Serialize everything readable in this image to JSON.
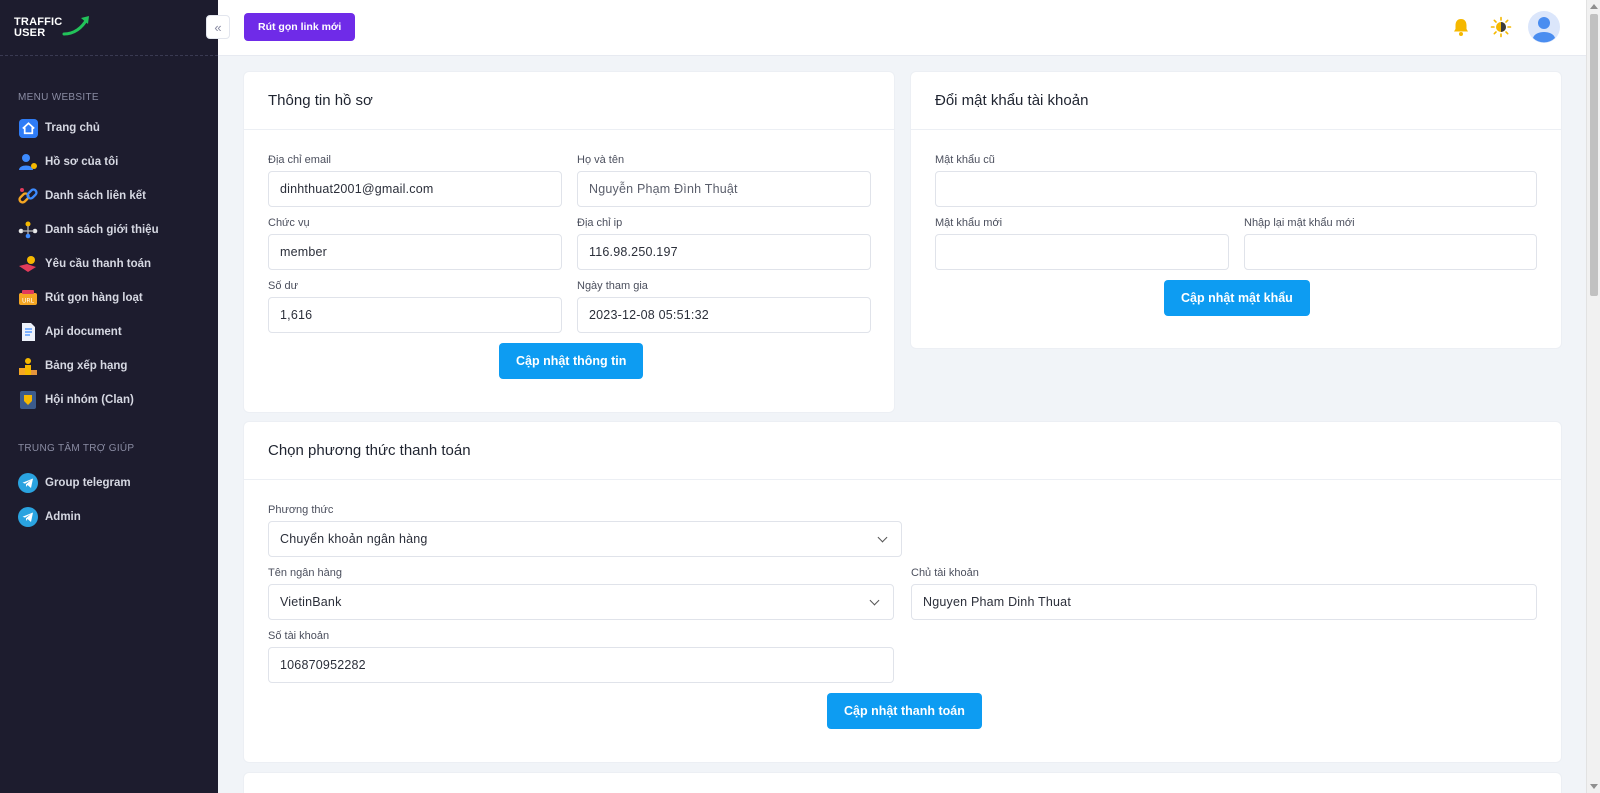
{
  "brand": {
    "line1": "TRAFFIC",
    "line2": "USER"
  },
  "sidebar": {
    "section_menu": "MENU WEBSITE",
    "items": [
      {
        "label": "Trang chủ",
        "icon": "home-icon"
      },
      {
        "label": "Hồ sơ của tôi",
        "icon": "user-profile-icon"
      },
      {
        "label": "Danh sách liên kết",
        "icon": "link-chain-icon"
      },
      {
        "label": "Danh sách giới thiệu",
        "icon": "referral-network-icon"
      },
      {
        "label": "Yêu cầu thanh toán",
        "icon": "payment-hand-icon"
      },
      {
        "label": "Rút gọn hàng loạt",
        "icon": "bulk-shorten-icon"
      },
      {
        "label": "Api document",
        "icon": "document-icon"
      },
      {
        "label": "Bảng xếp hạng",
        "icon": "ranking-podium-icon"
      },
      {
        "label": "Hội nhóm (Clan)",
        "icon": "clan-shield-icon"
      }
    ],
    "section_help": "TRUNG TÂM TRỢ GIÚP",
    "help_items": [
      {
        "label": "Group telegram",
        "icon": "telegram-icon"
      },
      {
        "label": "Admin",
        "icon": "telegram-icon"
      }
    ]
  },
  "header": {
    "new_link_label": "Rút gọn link mới",
    "icons": [
      "bell-icon",
      "theme-toggle-icon",
      "avatar-icon"
    ]
  },
  "profile": {
    "title": "Thông tin hồ sơ",
    "email_label": "Địa chỉ email",
    "email_value": "dinhthuat2001@gmail.com",
    "name_label": "Họ và tên",
    "name_value": "Nguyễn Phạm Đình Thuật",
    "role_label": "Chức vụ",
    "role_value": "member",
    "ip_label": "Địa chỉ ip",
    "ip_value": "116.98.250.197",
    "balance_label": "Số dư",
    "balance_value": "1,616",
    "joined_label": "Ngày tham gia",
    "joined_value": "2023-12-08 05:51:32",
    "submit_label": "Cập nhật thông tin"
  },
  "password": {
    "title": "Đổi mật khẩu tài khoản",
    "old_label": "Mật khẩu cũ",
    "new_label": "Mật khẩu mới",
    "confirm_label": "Nhập lại mật khẩu mới",
    "submit_label": "Cập nhật mật khẩu"
  },
  "payment": {
    "title": "Chọn phương thức thanh toán",
    "method_label": "Phương thức",
    "method_value": "Chuyển khoản ngân hàng",
    "bank_label": "Tên ngân hàng",
    "bank_value": "VietinBank",
    "owner_label": "Chủ tài khoản",
    "owner_value": "Nguyen Pham Dinh Thuat",
    "account_label": "Số tài khoản",
    "account_value": "106870952282",
    "submit_label": "Cập nhật thanh toán"
  },
  "colors": {
    "sidebar_bg": "#1d1c2e",
    "primary_blue": "#0d9cf2",
    "purple_btn": "#6f2be8",
    "bell": "#f5b800"
  }
}
